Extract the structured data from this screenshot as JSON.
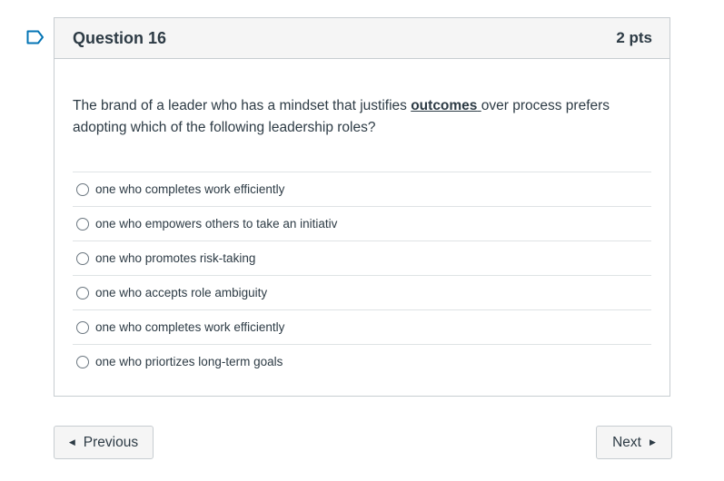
{
  "question": {
    "title": "Question 16",
    "points": "2 pts",
    "text_before": "The brand of a leader who  has a mindset that justifies ",
    "text_emphasis": "outcomes",
    "text_space": " ",
    "text_after": "over process prefers adopting which  of the following leadership roles?"
  },
  "answers": [
    {
      "label": "one who completes work efficiently"
    },
    {
      "label": "one who empowers others to take an initiativ"
    },
    {
      "label": "one who promotes risk-taking"
    },
    {
      "label": "one who accepts role ambiguity"
    },
    {
      "label": "one who completes work efficiently"
    },
    {
      "label": "one who priortizes long-term goals"
    }
  ],
  "navigation": {
    "previous_label": "Previous",
    "next_label": "Next"
  },
  "icons": {
    "flag": "flag-icon",
    "previous_arrow": "caret-left-icon",
    "next_arrow": "caret-right-icon"
  },
  "colors": {
    "text": "#2d3b45",
    "border": "#c7cdd1",
    "header_bg": "#f5f5f5",
    "flag": "#0374b5"
  }
}
